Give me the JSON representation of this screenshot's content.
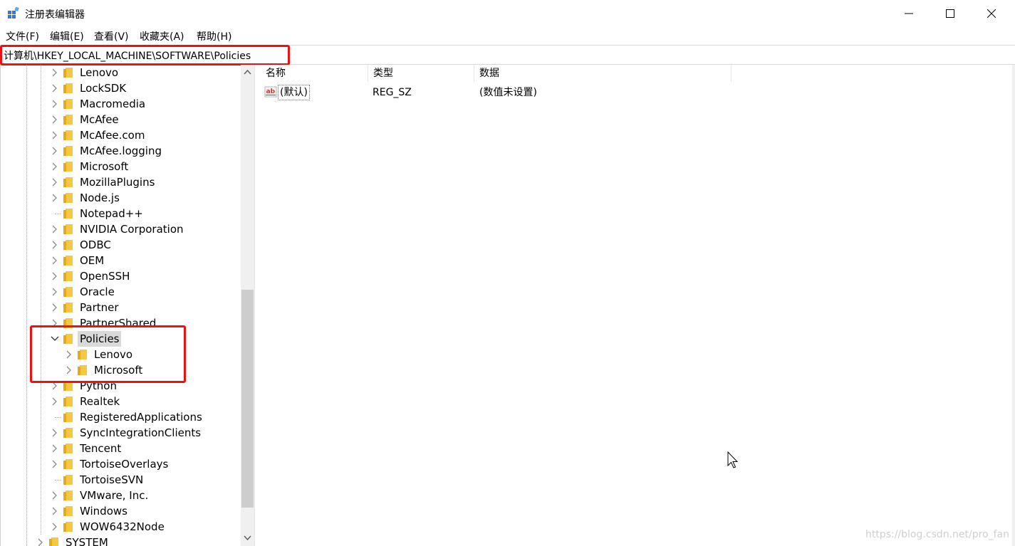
{
  "window": {
    "title": "注册表编辑器",
    "minimize_icon": "minimize-icon",
    "maximize_icon": "maximize-icon",
    "close_icon": "close-icon"
  },
  "menu": [
    {
      "label": "文件(F)"
    },
    {
      "label": "编辑(E)"
    },
    {
      "label": "查看(V)"
    },
    {
      "label": "收藏夹(A)"
    },
    {
      "label": "帮助(H)"
    }
  ],
  "address": {
    "path": "计算机\\HKEY_LOCAL_MACHINE\\SOFTWARE\\Policies"
  },
  "tree": {
    "items": [
      {
        "label": "Lenovo",
        "expandable": true
      },
      {
        "label": "LockSDK",
        "expandable": true
      },
      {
        "label": "Macromedia",
        "expandable": true
      },
      {
        "label": "McAfee",
        "expandable": true
      },
      {
        "label": "McAfee.com",
        "expandable": true
      },
      {
        "label": "McAfee.logging",
        "expandable": true
      },
      {
        "label": "Microsoft",
        "expandable": true
      },
      {
        "label": "MozillaPlugins",
        "expandable": true
      },
      {
        "label": "Node.js",
        "expandable": true
      },
      {
        "label": "Notepad++",
        "expandable": false
      },
      {
        "label": "NVIDIA Corporation",
        "expandable": true
      },
      {
        "label": "ODBC",
        "expandable": true
      },
      {
        "label": "OEM",
        "expandable": true
      },
      {
        "label": "OpenSSH",
        "expandable": true
      },
      {
        "label": "Oracle",
        "expandable": true
      },
      {
        "label": "Partner",
        "expandable": true
      },
      {
        "label": "PartnerShared",
        "expandable": true
      },
      {
        "label": "Policies",
        "expandable": true,
        "expanded": true,
        "selected": true
      },
      {
        "label": "Lenovo",
        "expandable": true,
        "child": true
      },
      {
        "label": "Microsoft",
        "expandable": true,
        "child": true
      },
      {
        "label": "Python",
        "expandable": true
      },
      {
        "label": "Realtek",
        "expandable": true
      },
      {
        "label": "RegisteredApplications",
        "expandable": false
      },
      {
        "label": "SyncIntegrationClients",
        "expandable": true
      },
      {
        "label": "Tencent",
        "expandable": true
      },
      {
        "label": "TortoiseOverlays",
        "expandable": true
      },
      {
        "label": "TortoiseSVN",
        "expandable": false
      },
      {
        "label": "VMware, Inc.",
        "expandable": true
      },
      {
        "label": "Windows",
        "expandable": true
      },
      {
        "label": "WOW6432Node",
        "expandable": true
      },
      {
        "label": "SYSTEM",
        "expandable": true,
        "root_level": true
      }
    ]
  },
  "list": {
    "columns": [
      {
        "label": "名称"
      },
      {
        "label": "类型"
      },
      {
        "label": "数据"
      }
    ],
    "rows": [
      {
        "name": "(默认)",
        "type": "REG_SZ",
        "data": "(数值未设置)",
        "icon": "string-value-icon"
      }
    ]
  },
  "watermark": "https://blog.csdn.net/pro_fan",
  "colors": {
    "highlight": "#ee1111",
    "folder": "#f5c842",
    "selection": "#d9d9d9"
  }
}
